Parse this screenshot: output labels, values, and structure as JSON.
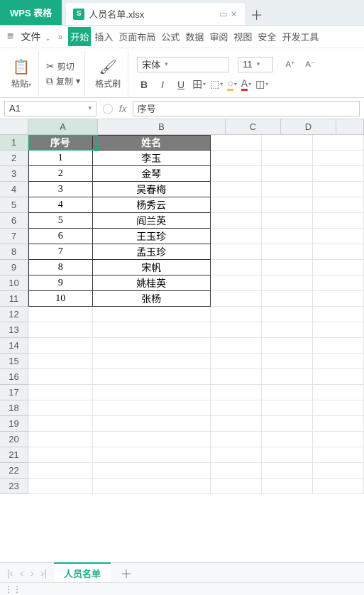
{
  "app": {
    "name": "WPS 表格"
  },
  "file_tab": {
    "icon_letter": "S",
    "name": "人员名单.xlsx"
  },
  "menu": {
    "file": "文件",
    "tabs": [
      "开始",
      "插入",
      "页面布局",
      "公式",
      "数据",
      "审阅",
      "视图",
      "安全",
      "开发工具"
    ],
    "active_index": 0
  },
  "ribbon": {
    "paste": "粘贴",
    "cut": "剪切",
    "copy": "复制",
    "format_painter": "格式刷",
    "font_name": "宋体",
    "font_size": "11",
    "a_increase": "A⁺",
    "a_decrease": "A⁻",
    "bold": "B",
    "italic": "I",
    "underline": "U"
  },
  "namebox": {
    "cell_ref": "A1"
  },
  "formula": {
    "value": "序号"
  },
  "columns": [
    "A",
    "B",
    "C",
    "D"
  ],
  "col_widths": {
    "A": 98,
    "B": 180,
    "C": 78,
    "D": 78
  },
  "row_count": 23,
  "active_cell": {
    "row": 1,
    "col": "A"
  },
  "table": {
    "headers": [
      "序号",
      "姓名"
    ],
    "rows": [
      [
        "1",
        "李玉"
      ],
      [
        "2",
        "金琴"
      ],
      [
        "3",
        "吴春梅"
      ],
      [
        "4",
        "杨秀云"
      ],
      [
        "5",
        "阎兰英"
      ],
      [
        "6",
        "王玉珍"
      ],
      [
        "7",
        "孟玉珍"
      ],
      [
        "8",
        "宋帆"
      ],
      [
        "9",
        "姚桂英"
      ],
      [
        "10",
        "张杨"
      ]
    ]
  },
  "sheet": {
    "name": "人员名单"
  }
}
